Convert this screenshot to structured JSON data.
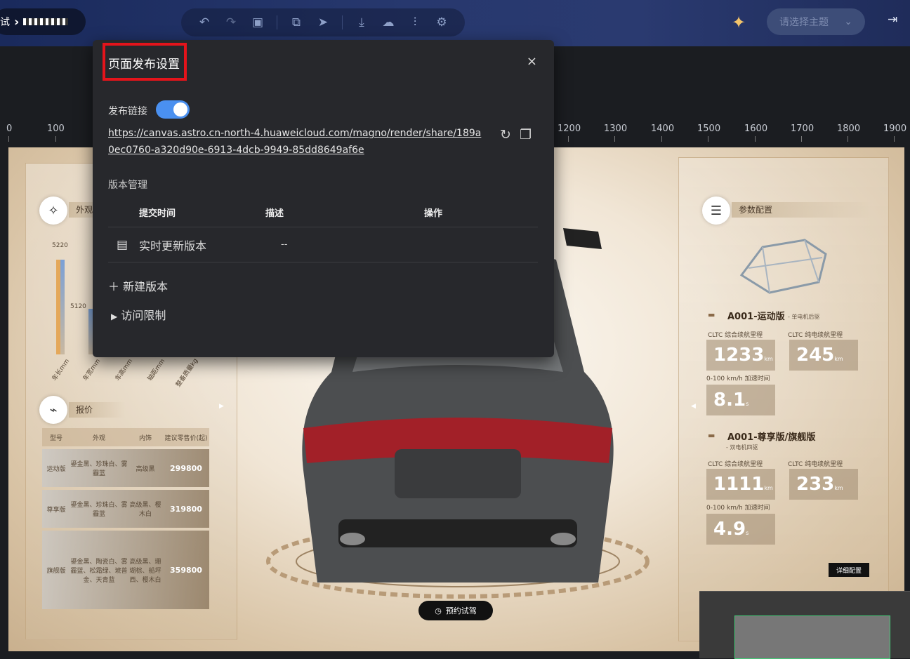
{
  "topbar": {
    "crumb_prefix": "试",
    "theme_placeholder": "请选择主题",
    "tools": [
      "undo-icon",
      "redo-icon",
      "save-icon",
      "preview-icon",
      "send-icon",
      "download-icon",
      "cloud-upload-icon",
      "adjust-icon",
      "settings-page-icon"
    ]
  },
  "ruler": {
    "ticks": [
      "0",
      "100",
      "1200",
      "1300",
      "1400",
      "1500",
      "1600",
      "1700",
      "1800",
      "1900"
    ]
  },
  "dialog": {
    "title": "页面发布设置",
    "close": "×",
    "publish_label": "发布链接",
    "publish_enabled": true,
    "link": "https://canvas.astro.cn-north-4.huaweicloud.com/magno/render/share/189a0ec0760-a320d90e-6913-4dcb-9949-85dd8649af6e",
    "version_section": "版本管理",
    "columns": {
      "time": "提交时间",
      "desc": "描述",
      "action": "操作"
    },
    "rows": [
      {
        "time": "实时更新版本",
        "desc": "--"
      }
    ],
    "new_version": "新建版本",
    "access": "访问限制"
  },
  "canvas": {
    "exterior_title": "外观",
    "price_title": "报价",
    "params_title": "参数配置",
    "bar_values": [
      "5220",
      "5120"
    ],
    "bar_labels": [
      "车长mm",
      "车宽mm",
      "车高mm",
      "轴距mm",
      "整备质量kg"
    ],
    "price_headers": [
      "型号",
      "外观",
      "内饰",
      "建议零售价(起)"
    ],
    "price_rows": [
      {
        "model": "运动版",
        "ext": "鎏金黑、珍珠白、雾霾蓝",
        "int": "高级黑",
        "price": "299800"
      },
      {
        "model": "尊享版",
        "ext": "鎏金黑、珍珠白、雾霾蓝",
        "int": "高级黑、樱木白",
        "price": "319800"
      },
      {
        "model": "旗舰版",
        "ext": "鎏金黑、陶瓷白、雾霾蓝、松霜绿、琥普金、天青蓝",
        "int": "高级黑、珊瑚棕、船坪西、樱木白",
        "price": "359800"
      }
    ],
    "models": [
      {
        "name": "A001-运动版",
        "sub": "- 单电机后驱",
        "cltc_label": "CLTC 综合续航里程",
        "cltc": "1233",
        "pure_label": "CLTC 纯电续航里程",
        "pure": "245",
        "accel_label": "0-100 km/h 加速时间",
        "accel": "8.1"
      },
      {
        "name": "A001-尊享版/旗舰版",
        "sub": "- 双电机四驱",
        "cltc_label": "CLTC 综合续航里程",
        "cltc": "1111",
        "pure_label": "CLTC 纯电续航里程",
        "pure": "233",
        "accel_label": "0-100 km/h 加速时间",
        "accel": "4.9"
      }
    ],
    "unit_km": "km",
    "unit_s": "s",
    "detail_button": "详细配置",
    "test_drive": "预约试驾"
  }
}
